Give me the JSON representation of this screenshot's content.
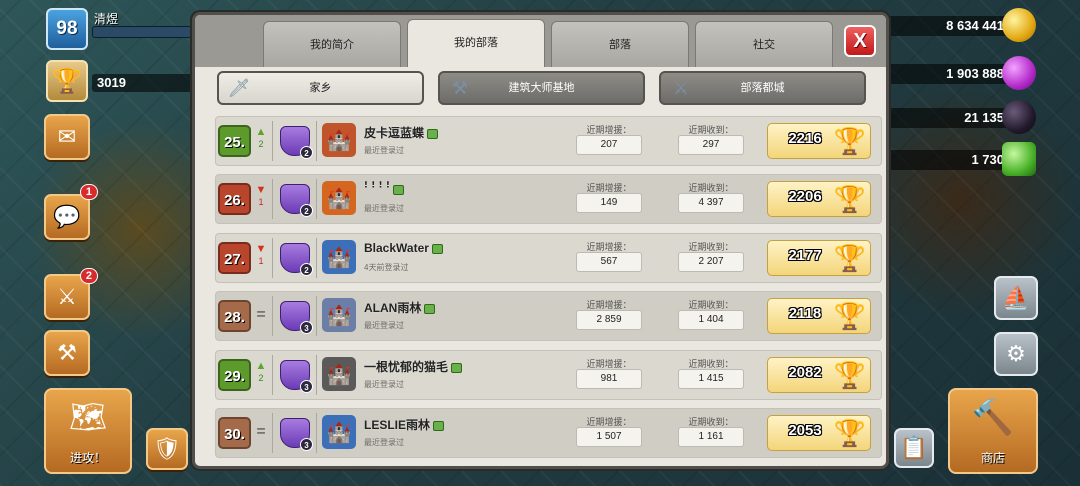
{
  "hud": {
    "level": "98",
    "player_name": "清煜",
    "trophies": "3019",
    "trophy_sub": "1",
    "chat_badge": "1",
    "war_badge": "2",
    "attack_label": "进攻！",
    "shop_label": "商店"
  },
  "resources": {
    "gold": "8 634 441",
    "elixir": "1 903 888",
    "dark_elixir": "21 135",
    "gems": "1 730"
  },
  "tabs": [
    {
      "label": "我的简介"
    },
    {
      "label": "我的部落"
    },
    {
      "label": "部落"
    },
    {
      "label": "社交"
    }
  ],
  "close_label": "X",
  "subtabs": [
    {
      "label": "家乡"
    },
    {
      "label": "建筑大师基地"
    },
    {
      "label": "部落都城"
    }
  ],
  "labels": {
    "donated": "近期增援：",
    "received": "近期收到："
  },
  "members": [
    {
      "rank": "25.",
      "trend": "up",
      "trend_num": "2",
      "league_lv": "2",
      "name": "皮卡逗蓝蝶",
      "last_seen": "最近登录过",
      "donated": "207",
      "received": "297",
      "trophies": "2216",
      "th_color": "#c0542a"
    },
    {
      "rank": "26.",
      "trend": "down",
      "trend_num": "1",
      "league_lv": "2",
      "name": "ꜝ ꜝ ꜝ ꜝ",
      "last_seen": "最近登录过",
      "donated": "149",
      "received": "4 397",
      "trophies": "2206",
      "th_color": "#d4661f"
    },
    {
      "rank": "27.",
      "trend": "down",
      "trend_num": "1",
      "league_lv": "2",
      "name": "BlackWater",
      "last_seen": "4天前登录过",
      "donated": "567",
      "received": "2 207",
      "trophies": "2177",
      "th_color": "#3d6fb8"
    },
    {
      "rank": "28.",
      "trend": "eq",
      "trend_num": "",
      "league_lv": "3",
      "name": "ALAN雨林",
      "last_seen": "最近登录过",
      "donated": "2 859",
      "received": "1 404",
      "trophies": "2118",
      "th_color": "#6b7ea8"
    },
    {
      "rank": "29.",
      "trend": "up",
      "trend_num": "2",
      "league_lv": "3",
      "name": "一根忧郁的猫毛",
      "last_seen": "最近登录过",
      "donated": "981",
      "received": "1 415",
      "trophies": "2082",
      "th_color": "#5a5a5a"
    },
    {
      "rank": "30.",
      "trend": "eq",
      "trend_num": "",
      "league_lv": "3",
      "name": "LESLIE雨林",
      "last_seen": "最近登录过",
      "donated": "1 507",
      "received": "1 161",
      "trophies": "2053",
      "th_color": "#3d6fb8"
    }
  ]
}
